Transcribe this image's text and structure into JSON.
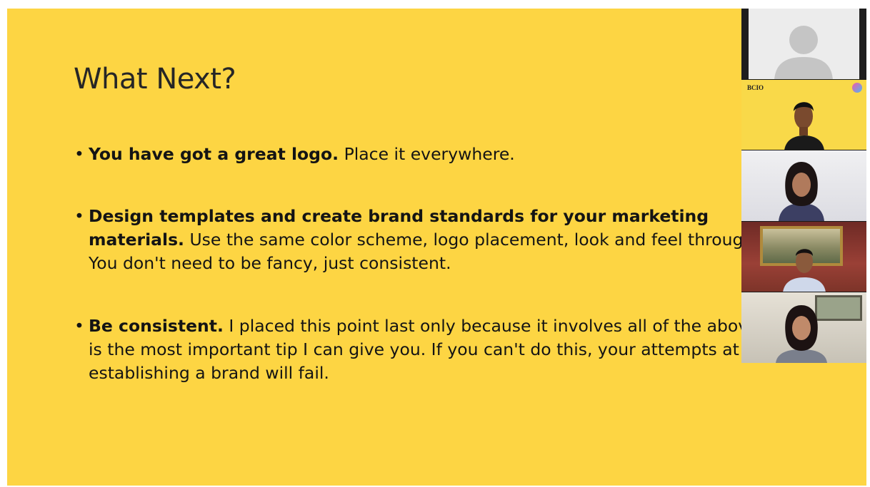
{
  "slide": {
    "title": "What Next?",
    "bullets": [
      {
        "lead": "You have got a great logo.",
        "text": " Place it everywhere."
      },
      {
        "lead": "Design templates and create brand standards for your marketing materials.",
        "text": " Use the same color scheme, logo placement, look and feel throughout. You don't need to be fancy, just consistent."
      },
      {
        "lead": "Be consistent.",
        "text": " I placed this point last only because it involves all of the above and is the most important tip I can give you. If you can't do this, your attempts at establishing a brand will fail."
      }
    ]
  },
  "video_panel": {
    "tiles": [
      {
        "kind": "no-video",
        "icon": "user-avatar-icon"
      },
      {
        "kind": "video",
        "icon": "person-icon",
        "brand": "BCIO"
      },
      {
        "kind": "video",
        "icon": "person-icon"
      },
      {
        "kind": "video",
        "icon": "person-icon"
      },
      {
        "kind": "video",
        "icon": "person-icon"
      }
    ]
  },
  "colors": {
    "slide_background": "#fdd543",
    "title": "#262626",
    "body_text": "#141414"
  }
}
